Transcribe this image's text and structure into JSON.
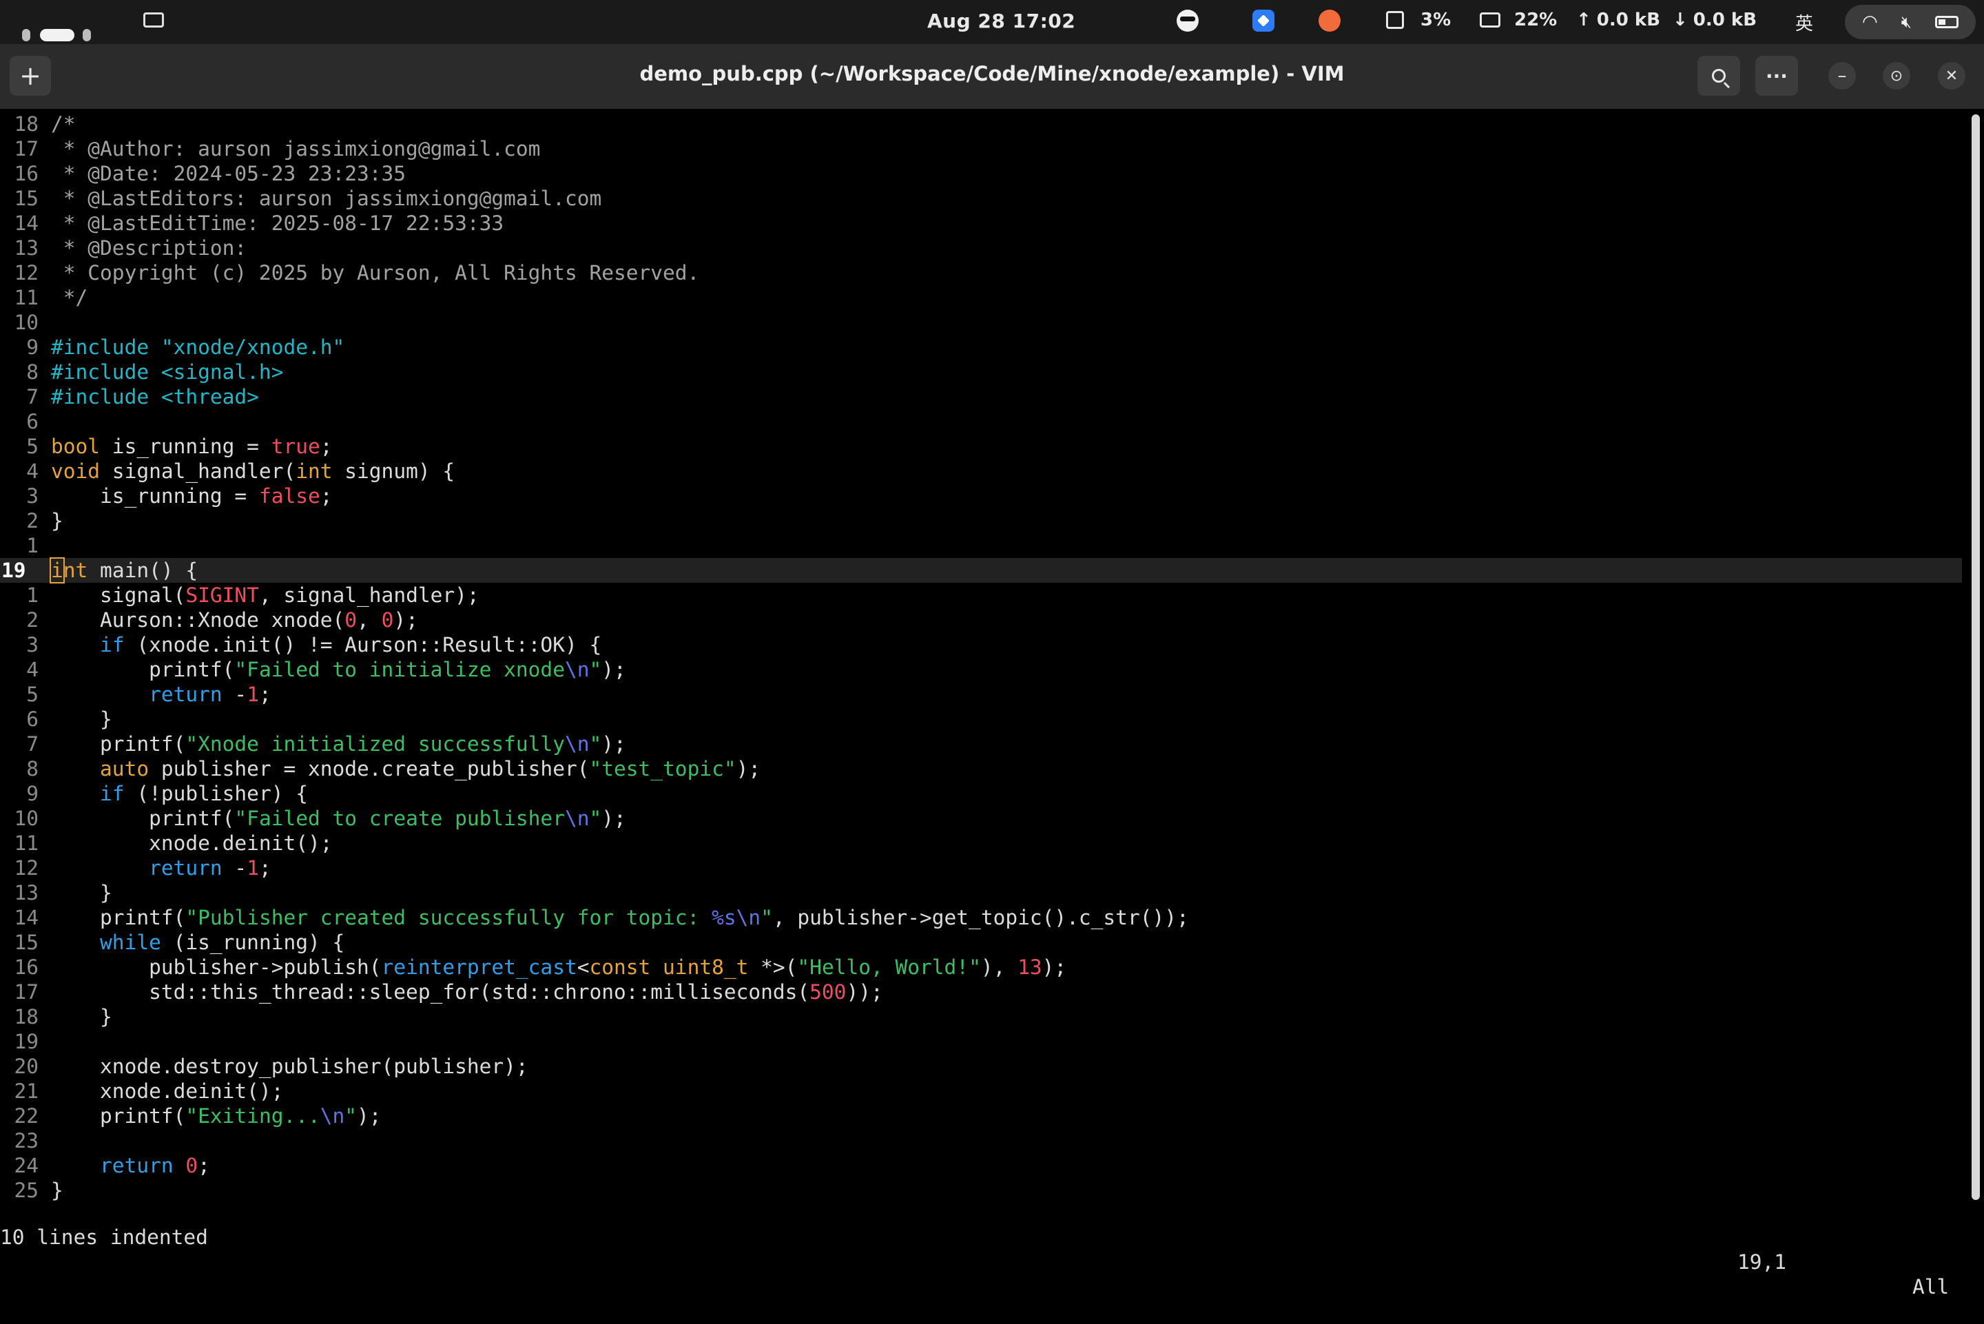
{
  "topbar": {
    "clock": "Aug 28  17:02",
    "cpu": "3%",
    "mem": "22%",
    "net_up": "0.0 kB",
    "net_down": "0.0 kB",
    "input_method": "英",
    "icons": [
      "workspace-indicator",
      "window-overview-icon",
      "glasses-face-icon",
      "app-blue-icon",
      "app-cat-icon",
      "cpu-icon",
      "memory-icon",
      "arrow-up-icon",
      "arrow-down-icon",
      "wifi-icon",
      "mute-icon",
      "battery-icon"
    ]
  },
  "titlebar": {
    "title": "demo_pub.cpp (~/Workspace/Code/Mine/xnode/example) - VIM",
    "new_tab": "+",
    "menu": "···",
    "minimize": "–",
    "restore": "⊙",
    "close": "✕"
  },
  "editor": {
    "lines": [
      {
        "n": "18",
        "segs": [
          {
            "c": "comment",
            "t": "/*"
          }
        ]
      },
      {
        "n": "17",
        "segs": [
          {
            "c": "comment",
            "t": " * @Author: aurson jassimxiong@gmail.com"
          }
        ]
      },
      {
        "n": "16",
        "segs": [
          {
            "c": "comment",
            "t": " * @Date: 2024-05-23 23:23:35"
          }
        ]
      },
      {
        "n": "15",
        "segs": [
          {
            "c": "comment",
            "t": " * @LastEditors: aurson jassimxiong@gmail.com"
          }
        ]
      },
      {
        "n": "14",
        "segs": [
          {
            "c": "comment",
            "t": " * @LastEditTime: 2025-08-17 22:53:33"
          }
        ]
      },
      {
        "n": "13",
        "segs": [
          {
            "c": "comment",
            "t": " * @Description:"
          }
        ]
      },
      {
        "n": "12",
        "segs": [
          {
            "c": "comment",
            "t": " * Copyright (c) 2025 by Aurson, All Rights Reserved."
          }
        ]
      },
      {
        "n": "11",
        "segs": [
          {
            "c": "comment",
            "t": " */"
          }
        ]
      },
      {
        "n": "10",
        "segs": []
      },
      {
        "n": "9",
        "segs": [
          {
            "c": "pre",
            "t": "#include \"xnode/xnode.h\""
          }
        ]
      },
      {
        "n": "8",
        "segs": [
          {
            "c": "pre",
            "t": "#include <signal.h>"
          }
        ]
      },
      {
        "n": "7",
        "segs": [
          {
            "c": "pre",
            "t": "#include <thread>"
          }
        ]
      },
      {
        "n": "6",
        "segs": []
      },
      {
        "n": "5",
        "segs": [
          {
            "c": "type",
            "t": "bool"
          },
          {
            "c": "plain",
            "t": " is_running = "
          },
          {
            "c": "const",
            "t": "true"
          },
          {
            "c": "plain",
            "t": ";"
          }
        ]
      },
      {
        "n": "4",
        "segs": [
          {
            "c": "type",
            "t": "void"
          },
          {
            "c": "plain",
            "t": " signal_handler("
          },
          {
            "c": "type",
            "t": "int"
          },
          {
            "c": "plain",
            "t": " signum) {"
          }
        ]
      },
      {
        "n": "3",
        "segs": [
          {
            "c": "plain",
            "t": "    is_running = "
          },
          {
            "c": "const",
            "t": "false"
          },
          {
            "c": "plain",
            "t": ";"
          }
        ]
      },
      {
        "n": "2",
        "segs": [
          {
            "c": "plain",
            "t": "}"
          }
        ]
      },
      {
        "n": "1",
        "segs": []
      },
      {
        "n": "19",
        "cur": true,
        "segs": [
          {
            "c": "type cursor",
            "t": "i"
          },
          {
            "c": "type",
            "t": "nt"
          },
          {
            "c": "plain",
            "t": " main() {"
          }
        ]
      },
      {
        "n": "1",
        "segs": [
          {
            "c": "plain",
            "t": "    signal("
          },
          {
            "c": "const",
            "t": "SIGINT"
          },
          {
            "c": "plain",
            "t": ", signal_handler);"
          }
        ]
      },
      {
        "n": "2",
        "segs": [
          {
            "c": "plain",
            "t": "    Aurson::Xnode xnode("
          },
          {
            "c": "const",
            "t": "0"
          },
          {
            "c": "plain",
            "t": ", "
          },
          {
            "c": "const",
            "t": "0"
          },
          {
            "c": "plain",
            "t": ");"
          }
        ]
      },
      {
        "n": "3",
        "segs": [
          {
            "c": "kw",
            "t": "    if"
          },
          {
            "c": "plain",
            "t": " (xnode.init() != Aurson::Result::OK) {"
          }
        ]
      },
      {
        "n": "4",
        "segs": [
          {
            "c": "plain",
            "t": "        printf("
          },
          {
            "c": "str",
            "t": "\"Failed to initialize xnode"
          },
          {
            "c": "esc",
            "t": "\\n"
          },
          {
            "c": "str",
            "t": "\""
          },
          {
            "c": "plain",
            "t": ");"
          }
        ]
      },
      {
        "n": "5",
        "segs": [
          {
            "c": "kw",
            "t": "        return"
          },
          {
            "c": "plain",
            "t": " -"
          },
          {
            "c": "const",
            "t": "1"
          },
          {
            "c": "plain",
            "t": ";"
          }
        ]
      },
      {
        "n": "6",
        "segs": [
          {
            "c": "plain",
            "t": "    }"
          }
        ]
      },
      {
        "n": "7",
        "segs": [
          {
            "c": "plain",
            "t": "    printf("
          },
          {
            "c": "str",
            "t": "\"Xnode initialized successfully"
          },
          {
            "c": "esc",
            "t": "\\n"
          },
          {
            "c": "str",
            "t": "\""
          },
          {
            "c": "plain",
            "t": ");"
          }
        ]
      },
      {
        "n": "8",
        "segs": [
          {
            "c": "type",
            "t": "    auto"
          },
          {
            "c": "plain",
            "t": " publisher = xnode.create_publisher("
          },
          {
            "c": "str",
            "t": "\"test_topic\""
          },
          {
            "c": "plain",
            "t": ");"
          }
        ]
      },
      {
        "n": "9",
        "segs": [
          {
            "c": "kw",
            "t": "    if"
          },
          {
            "c": "plain",
            "t": " (!publisher) {"
          }
        ]
      },
      {
        "n": "10",
        "segs": [
          {
            "c": "plain",
            "t": "        printf("
          },
          {
            "c": "str",
            "t": "\"Failed to create publisher"
          },
          {
            "c": "esc",
            "t": "\\n"
          },
          {
            "c": "str",
            "t": "\""
          },
          {
            "c": "plain",
            "t": ");"
          }
        ]
      },
      {
        "n": "11",
        "segs": [
          {
            "c": "plain",
            "t": "        xnode.deinit();"
          }
        ]
      },
      {
        "n": "12",
        "segs": [
          {
            "c": "kw",
            "t": "        return"
          },
          {
            "c": "plain",
            "t": " -"
          },
          {
            "c": "const",
            "t": "1"
          },
          {
            "c": "plain",
            "t": ";"
          }
        ]
      },
      {
        "n": "13",
        "segs": [
          {
            "c": "plain",
            "t": "    }"
          }
        ]
      },
      {
        "n": "14",
        "segs": [
          {
            "c": "plain",
            "t": "    printf("
          },
          {
            "c": "str",
            "t": "\"Publisher created successfully for topic: "
          },
          {
            "c": "esc",
            "t": "%s\\n"
          },
          {
            "c": "str",
            "t": "\""
          },
          {
            "c": "plain",
            "t": ", publisher->get_topic().c_str());"
          }
        ]
      },
      {
        "n": "15",
        "segs": [
          {
            "c": "kw",
            "t": "    while"
          },
          {
            "c": "plain",
            "t": " (is_running) {"
          }
        ]
      },
      {
        "n": "16",
        "segs": [
          {
            "c": "plain",
            "t": "        publisher->publish("
          },
          {
            "c": "kw",
            "t": "reinterpret_cast"
          },
          {
            "c": "plain",
            "t": "<"
          },
          {
            "c": "type",
            "t": "const uint8_t"
          },
          {
            "c": "plain",
            "t": " *>("
          },
          {
            "c": "str",
            "t": "\"Hello, World!\""
          },
          {
            "c": "plain",
            "t": "), "
          },
          {
            "c": "const",
            "t": "13"
          },
          {
            "c": "plain",
            "t": ");"
          }
        ]
      },
      {
        "n": "17",
        "segs": [
          {
            "c": "plain",
            "t": "        std::this_thread::sleep_for(std::chrono::milliseconds("
          },
          {
            "c": "const",
            "t": "500"
          },
          {
            "c": "plain",
            "t": "));"
          }
        ]
      },
      {
        "n": "18",
        "segs": [
          {
            "c": "plain",
            "t": "    }"
          }
        ]
      },
      {
        "n": "19",
        "segs": []
      },
      {
        "n": "20",
        "segs": [
          {
            "c": "plain",
            "t": "    xnode.destroy_publisher(publisher);"
          }
        ]
      },
      {
        "n": "21",
        "segs": [
          {
            "c": "plain",
            "t": "    xnode.deinit();"
          }
        ]
      },
      {
        "n": "22",
        "segs": [
          {
            "c": "plain",
            "t": "    printf("
          },
          {
            "c": "str",
            "t": "\"Exiting..."
          },
          {
            "c": "esc",
            "t": "\\n"
          },
          {
            "c": "str",
            "t": "\""
          },
          {
            "c": "plain",
            "t": ");"
          }
        ]
      },
      {
        "n": "23",
        "segs": []
      },
      {
        "n": "24",
        "segs": [
          {
            "c": "kw",
            "t": "    return"
          },
          {
            "c": "plain",
            "t": " "
          },
          {
            "c": "const",
            "t": "0"
          },
          {
            "c": "plain",
            "t": ";"
          }
        ]
      },
      {
        "n": "25",
        "segs": [
          {
            "c": "plain",
            "t": "}"
          }
        ]
      }
    ]
  },
  "status": {
    "message": "10 lines indented",
    "position": "19,1",
    "scroll": "All"
  }
}
